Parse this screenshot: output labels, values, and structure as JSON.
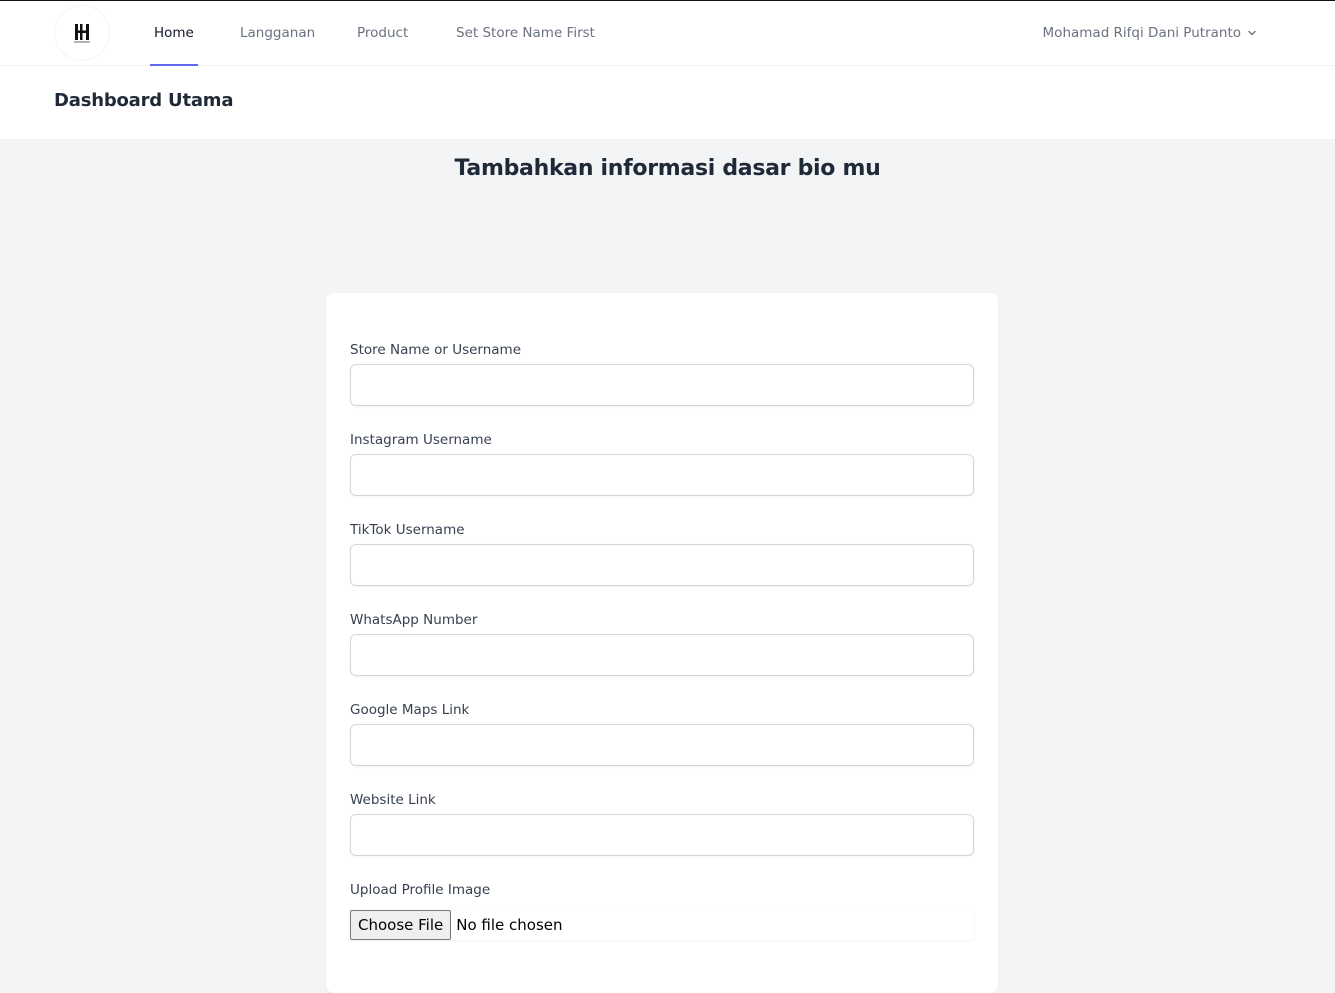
{
  "navbar": {
    "logo_icon": "store-logo-icon",
    "links": [
      {
        "label": "Home",
        "active": true
      },
      {
        "label": "Langganan",
        "active": false
      },
      {
        "label": "Product",
        "active": false
      },
      {
        "label": "Set Store Name First",
        "active": false
      }
    ],
    "user_name": "Mohamad Rifqi Dani Putranto",
    "user_icon": "chevron-down-icon",
    "accent_color": "#6366f1"
  },
  "header": {
    "title": "Dashboard Utama"
  },
  "main": {
    "heading": "Tambahkan informasi dasar bio mu",
    "form": {
      "fields": [
        {
          "label": "Store Name or Username",
          "value": ""
        },
        {
          "label": "Instagram Username",
          "value": ""
        },
        {
          "label": "TikTok Username",
          "value": ""
        },
        {
          "label": "WhatsApp Number",
          "value": ""
        },
        {
          "label": "Google Maps Link",
          "value": ""
        },
        {
          "label": "Website Link",
          "value": ""
        }
      ],
      "upload": {
        "label": "Upload Profile Image",
        "button_label": "Choose File",
        "status": "No file chosen"
      }
    }
  }
}
